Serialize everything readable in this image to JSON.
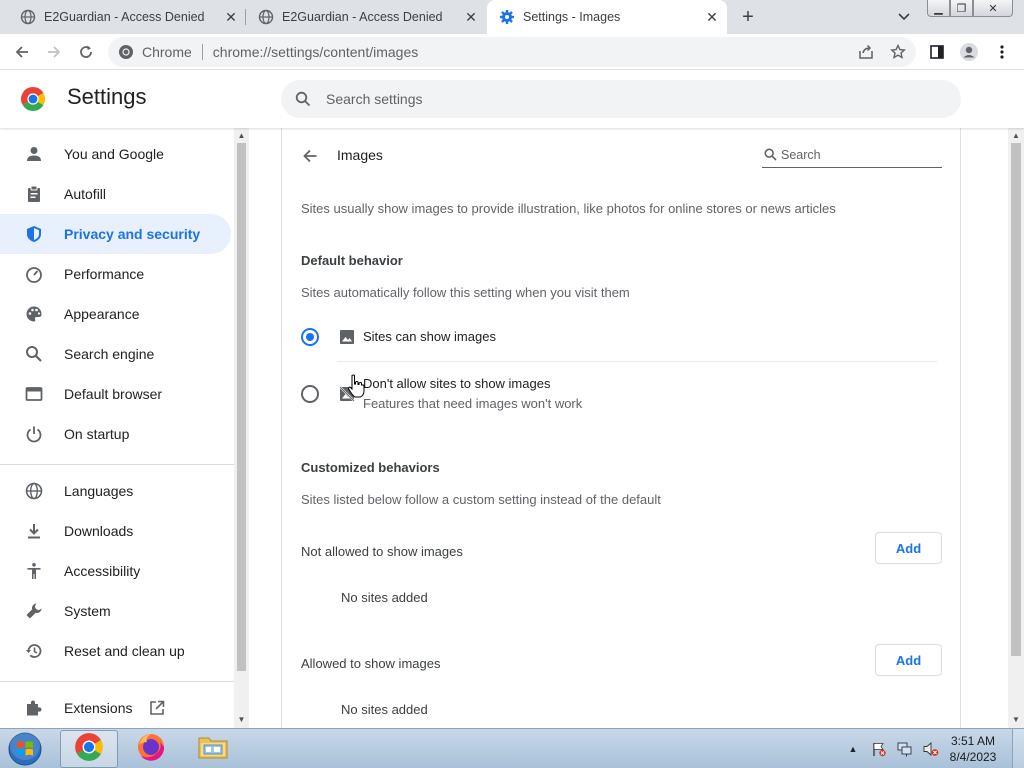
{
  "browser": {
    "tabs": [
      {
        "title": "E2Guardian - Access Denied",
        "active": false,
        "icon": "globe-icon"
      },
      {
        "title": "E2Guardian - Access Denied",
        "active": false,
        "icon": "globe-icon"
      },
      {
        "title": "Settings - Images",
        "active": true,
        "icon": "gear-icon"
      }
    ],
    "omnibox": {
      "chip": "Chrome",
      "url": "chrome://settings/content/images"
    }
  },
  "settings": {
    "title": "Settings",
    "search_placeholder": "Search settings"
  },
  "sidebar": {
    "items": [
      {
        "label": "You and Google",
        "icon": "person-icon",
        "selected": false
      },
      {
        "label": "Autofill",
        "icon": "clipboard-icon",
        "selected": false
      },
      {
        "label": "Privacy and security",
        "icon": "shield-icon",
        "selected": true
      },
      {
        "label": "Performance",
        "icon": "speedometer-icon",
        "selected": false
      },
      {
        "label": "Appearance",
        "icon": "palette-icon",
        "selected": false
      },
      {
        "label": "Search engine",
        "icon": "search-icon",
        "selected": false
      },
      {
        "label": "Default browser",
        "icon": "browser-window-icon",
        "selected": false
      },
      {
        "label": "On startup",
        "icon": "power-icon",
        "selected": false
      },
      {
        "label": "Languages",
        "icon": "globe-icon",
        "selected": false
      },
      {
        "label": "Downloads",
        "icon": "download-icon",
        "selected": false
      },
      {
        "label": "Accessibility",
        "icon": "accessibility-icon",
        "selected": false
      },
      {
        "label": "System",
        "icon": "wrench-icon",
        "selected": false
      },
      {
        "label": "Reset and clean up",
        "icon": "history-icon",
        "selected": false
      },
      {
        "label": "Extensions",
        "icon": "puzzle-icon",
        "selected": false
      }
    ]
  },
  "page": {
    "title": "Images",
    "search_placeholder": "Search",
    "description": "Sites usually show images to provide illustration, like photos for online stores or news articles",
    "default_behavior": {
      "heading": "Default behavior",
      "description": "Sites automatically follow this setting when you visit them",
      "options": [
        {
          "label": "Sites can show images",
          "sublabel": "",
          "checked": true,
          "icon": "image-icon"
        },
        {
          "label": "Don't allow sites to show images",
          "sublabel": "Features that need images won't work",
          "checked": false,
          "icon": "image-off-icon"
        }
      ]
    },
    "customized": {
      "heading": "Customized behaviors",
      "description": "Sites listed below follow a custom setting instead of the default",
      "lists": [
        {
          "heading": "Not allowed to show images",
          "add_label": "Add",
          "empty_text": "No sites added"
        },
        {
          "heading": "Allowed to show images",
          "add_label": "Add",
          "empty_text": "No sites added"
        }
      ]
    }
  },
  "taskbar": {
    "time": "3:51 AM",
    "date": "8/4/2023"
  },
  "colors": {
    "accent": "#1a73e8",
    "selected_bg": "#e8f0fe",
    "tabstrip": "#dee1e6"
  }
}
